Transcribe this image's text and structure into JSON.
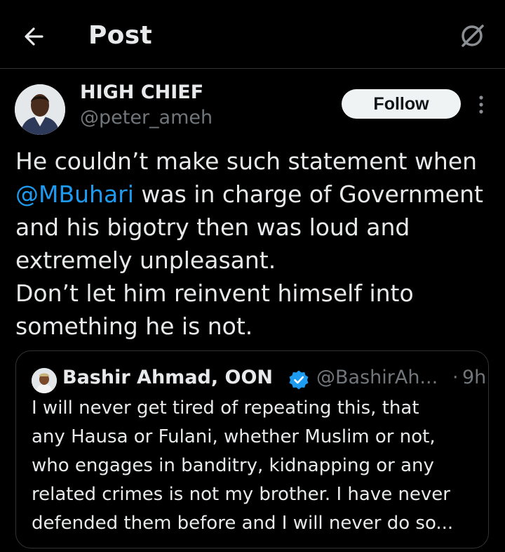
{
  "header": {
    "title": "Post",
    "back_icon": "back-arrow-icon",
    "grok_icon": "grok-icon"
  },
  "post": {
    "author": {
      "display_name": "HIGH CHIEF",
      "handle": "@peter_ameh",
      "avatar_icon": "avatar"
    },
    "follow_label": "Follow",
    "text": {
      "line1": "He couldn’t make such statement when",
      "mention": "@MBuhari",
      "line2_rest": " was in charge of Government",
      "line3": "and his bigotry then was loud and",
      "line4": "extremely unpleasant.",
      "line5": "Don’t let him reinvent himself into",
      "line6": "something he is not."
    }
  },
  "quoted_post": {
    "display_name": "Bashir Ahmad, OON",
    "verified": true,
    "handle": "@BashirAh...",
    "separator": "·",
    "time": "9h",
    "lines": [
      "I will never get tired of repeating this, that",
      "any Hausa or Fulani, whether Muslim or not,",
      "who engages in banditry, kidnapping or any",
      "related crimes is not my brother. I have never",
      "defended them before and I will never do so..."
    ]
  },
  "colors": {
    "background": "#000000",
    "text": "#e7e9ea",
    "secondary_text": "#71767b",
    "accent": "#1d9bf0",
    "divider": "#2f3336",
    "follow_bg": "#eff3f4"
  }
}
